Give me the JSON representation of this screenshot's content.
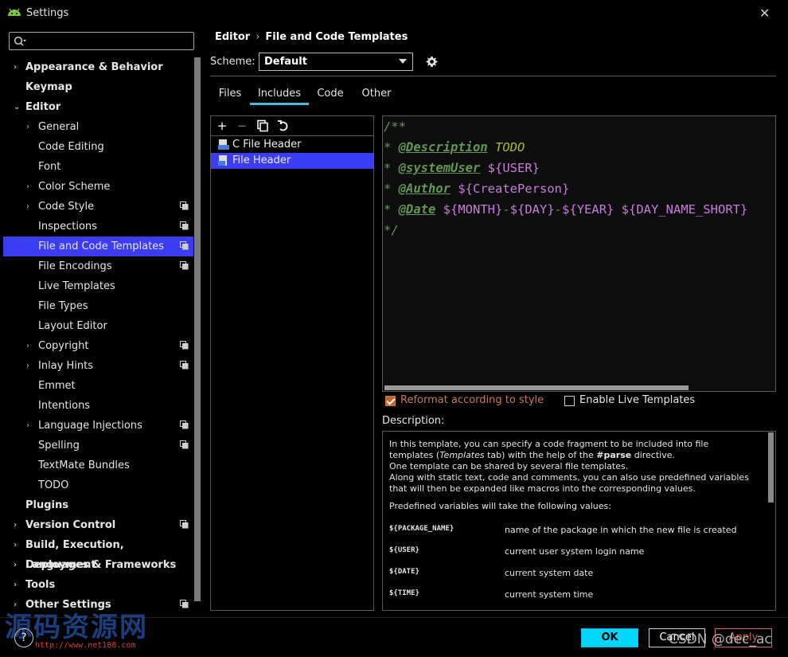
{
  "window": {
    "title": "Settings",
    "close": "✕"
  },
  "search": {
    "placeholder": ""
  },
  "sidebar": {
    "items": [
      {
        "label": "Appearance & Behavior",
        "bold": true,
        "arrow": "›",
        "level": 0
      },
      {
        "label": "Keymap",
        "bold": true,
        "level": 0
      },
      {
        "label": "Editor",
        "bold": true,
        "arrow": "⌄",
        "level": 0
      },
      {
        "label": "General",
        "arrow": "›",
        "level": 1
      },
      {
        "label": "Code Editing",
        "level": 1
      },
      {
        "label": "Font",
        "level": 1
      },
      {
        "label": "Color Scheme",
        "arrow": "›",
        "level": 1
      },
      {
        "label": "Code Style",
        "arrow": "›",
        "level": 1,
        "copy": true
      },
      {
        "label": "Inspections",
        "level": 1,
        "copy": true
      },
      {
        "label": "File and Code Templates",
        "level": 1,
        "copy": true,
        "selected": true
      },
      {
        "label": "File Encodings",
        "level": 1,
        "copy": true
      },
      {
        "label": "Live Templates",
        "level": 1
      },
      {
        "label": "File Types",
        "level": 1
      },
      {
        "label": "Layout Editor",
        "level": 1
      },
      {
        "label": "Copyright",
        "arrow": "›",
        "level": 1,
        "copy": true
      },
      {
        "label": "Inlay Hints",
        "arrow": "›",
        "level": 1,
        "copy": true
      },
      {
        "label": "Emmet",
        "level": 1
      },
      {
        "label": "Intentions",
        "level": 1
      },
      {
        "label": "Language Injections",
        "arrow": "›",
        "level": 1,
        "copy": true
      },
      {
        "label": "Spelling",
        "level": 1,
        "copy": true
      },
      {
        "label": "TextMate Bundles",
        "level": 1
      },
      {
        "label": "TODO",
        "level": 1
      },
      {
        "label": "Plugins",
        "bold": true,
        "level": 0
      },
      {
        "label": "Version Control",
        "bold": true,
        "arrow": "›",
        "level": 0,
        "copy": true
      },
      {
        "label": "Build, Execution, Deployment",
        "bold": true,
        "arrow": "›",
        "level": 0
      },
      {
        "label": "Languages & Frameworks",
        "bold": true,
        "arrow": "›",
        "level": 0
      },
      {
        "label": "Tools",
        "bold": true,
        "arrow": "›",
        "level": 0
      },
      {
        "label": "Other Settings",
        "bold": true,
        "arrow": "›",
        "level": 0,
        "copy": true
      }
    ]
  },
  "breadcrumb": {
    "parent": "Editor",
    "separator": "›",
    "current": "File and Code Templates"
  },
  "scheme": {
    "label": "Scheme:",
    "value": "Default"
  },
  "tabs": [
    {
      "label": "Files"
    },
    {
      "label": "Includes",
      "active": true
    },
    {
      "label": "Code"
    },
    {
      "label": "Other"
    }
  ],
  "templates": [
    {
      "label": "C File Header",
      "selected": false
    },
    {
      "label": "File Header",
      "selected": true
    }
  ],
  "editor": {
    "lines": [
      [
        {
          "t": "/**",
          "c": "c-comment"
        }
      ],
      [
        {
          "t": "* ",
          "c": "c-comment"
        },
        {
          "t": "@Description",
          "c": "c-tag"
        },
        {
          "t": " TODO",
          "c": "c-todo"
        }
      ],
      [
        {
          "t": "* ",
          "c": "c-comment"
        },
        {
          "t": "@systemUser",
          "c": "c-tag"
        },
        {
          "t": " ${USER}",
          "c": "c-var"
        }
      ],
      [
        {
          "t": "* ",
          "c": "c-comment"
        },
        {
          "t": "@Author",
          "c": "c-tag"
        },
        {
          "t": " ${CreatePerson}",
          "c": "c-var"
        }
      ],
      [
        {
          "t": "* ",
          "c": "c-comment"
        },
        {
          "t": "@Date",
          "c": "c-tag"
        },
        {
          "t": " ${MONTH}",
          "c": "c-var"
        },
        {
          "t": "-",
          "c": "c-comment"
        },
        {
          "t": "${DAY}",
          "c": "c-var"
        },
        {
          "t": "-",
          "c": "c-comment"
        },
        {
          "t": "${YEAR} ${DAY_NAME_SHORT}",
          "c": "c-var"
        }
      ],
      [
        {
          "t": "*/",
          "c": "c-comment"
        }
      ]
    ]
  },
  "options": {
    "reformat_label": "Reformat according to style",
    "reformat_checked": true,
    "live_label": "Enable Live Templates",
    "live_checked": false
  },
  "description": {
    "label": "Description:",
    "p1a": "In this template, you can specify a code fragment to be included into file templates (",
    "p1b": "Templates",
    "p1c": " tab) with the help of the ",
    "p1d": "#parse",
    "p1e": " directive.",
    "p2": "One template can be shared by several file templates.",
    "p3": "Along with static text, code and comments, you can also use predefined variables that will then be expanded like macros into the corresponding values.",
    "p4": "Predefined variables will take the following values:",
    "vars": [
      {
        "name": "${PACKAGE_NAME}",
        "desc": "name of the package in which the new file is created"
      },
      {
        "name": "${USER}",
        "desc": "current user system login name"
      },
      {
        "name": "${DATE}",
        "desc": "current system date"
      },
      {
        "name": "${TIME}",
        "desc": "current system time"
      }
    ]
  },
  "buttons": {
    "ok": "OK",
    "cancel": "Cancel",
    "apply": "Apply",
    "help": "?"
  },
  "watermark": {
    "text": "源码资源网",
    "url": "http://www.net188.com",
    "csdn": "CSDN @dec_ac"
  },
  "colors": {
    "selection": "#3c3cf2",
    "accent": "#00d7ff",
    "comment": "#629755",
    "variable": "#c77dde"
  }
}
